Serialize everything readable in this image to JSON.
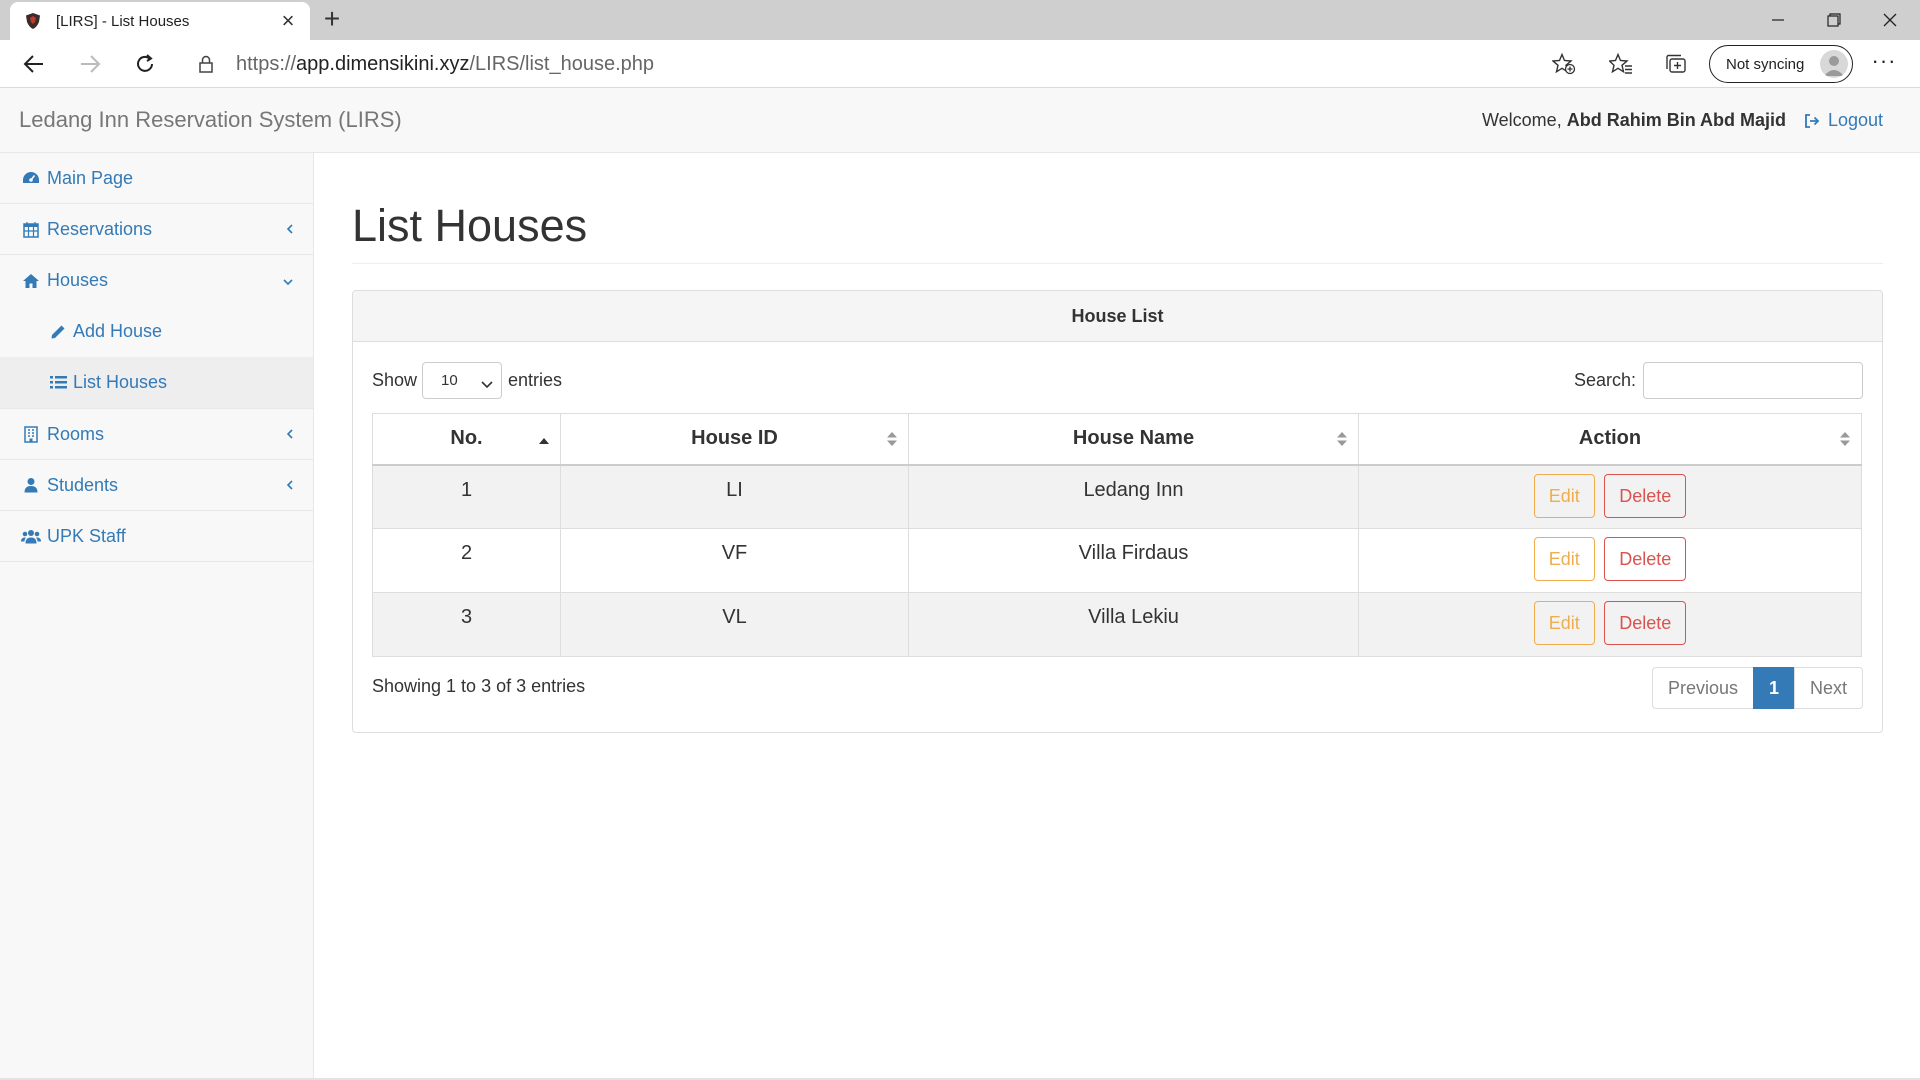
{
  "browser": {
    "tab_title": "[LIRS] - List Houses",
    "url_scheme": "https://",
    "url_host": "app.dimensikini.xyz",
    "url_path": "/LIRS/list_house.php",
    "sync_label": "Not syncing"
  },
  "header": {
    "brand": "Ledang Inn Reservation System (LIRS)",
    "welcome_prefix": "Welcome, ",
    "user_name": "Abd Rahim Bin Abd Majid",
    "logout_label": "Logout"
  },
  "sidebar": {
    "main_page": "Main Page",
    "reservations": "Reservations",
    "houses": "Houses",
    "add_house": "Add House",
    "list_houses": "List Houses",
    "rooms": "Rooms",
    "students": "Students",
    "upk_staff": "UPK Staff"
  },
  "main": {
    "page_title": "List Houses",
    "panel_heading": "House List",
    "show_label": "Show",
    "entries_label": "entries",
    "page_length": "10",
    "search_label": "Search:",
    "columns": [
      "No.",
      "House ID",
      "House Name",
      "Action"
    ],
    "rows": [
      {
        "no": "1",
        "house_id": "LI",
        "house_name": "Ledang Inn"
      },
      {
        "no": "2",
        "house_id": "VF",
        "house_name": "Villa Firdaus"
      },
      {
        "no": "3",
        "house_id": "VL",
        "house_name": "Villa Lekiu"
      }
    ],
    "edit_label": "Edit",
    "delete_label": "Delete",
    "info": "Showing 1 to 3 of 3 entries",
    "pagination": {
      "previous": "Previous",
      "current": "1",
      "next": "Next"
    }
  },
  "colors": {
    "link": "#337ab7",
    "edit": "#f0ad4e",
    "delete": "#d9534f",
    "pager_active": "#337ab7"
  }
}
